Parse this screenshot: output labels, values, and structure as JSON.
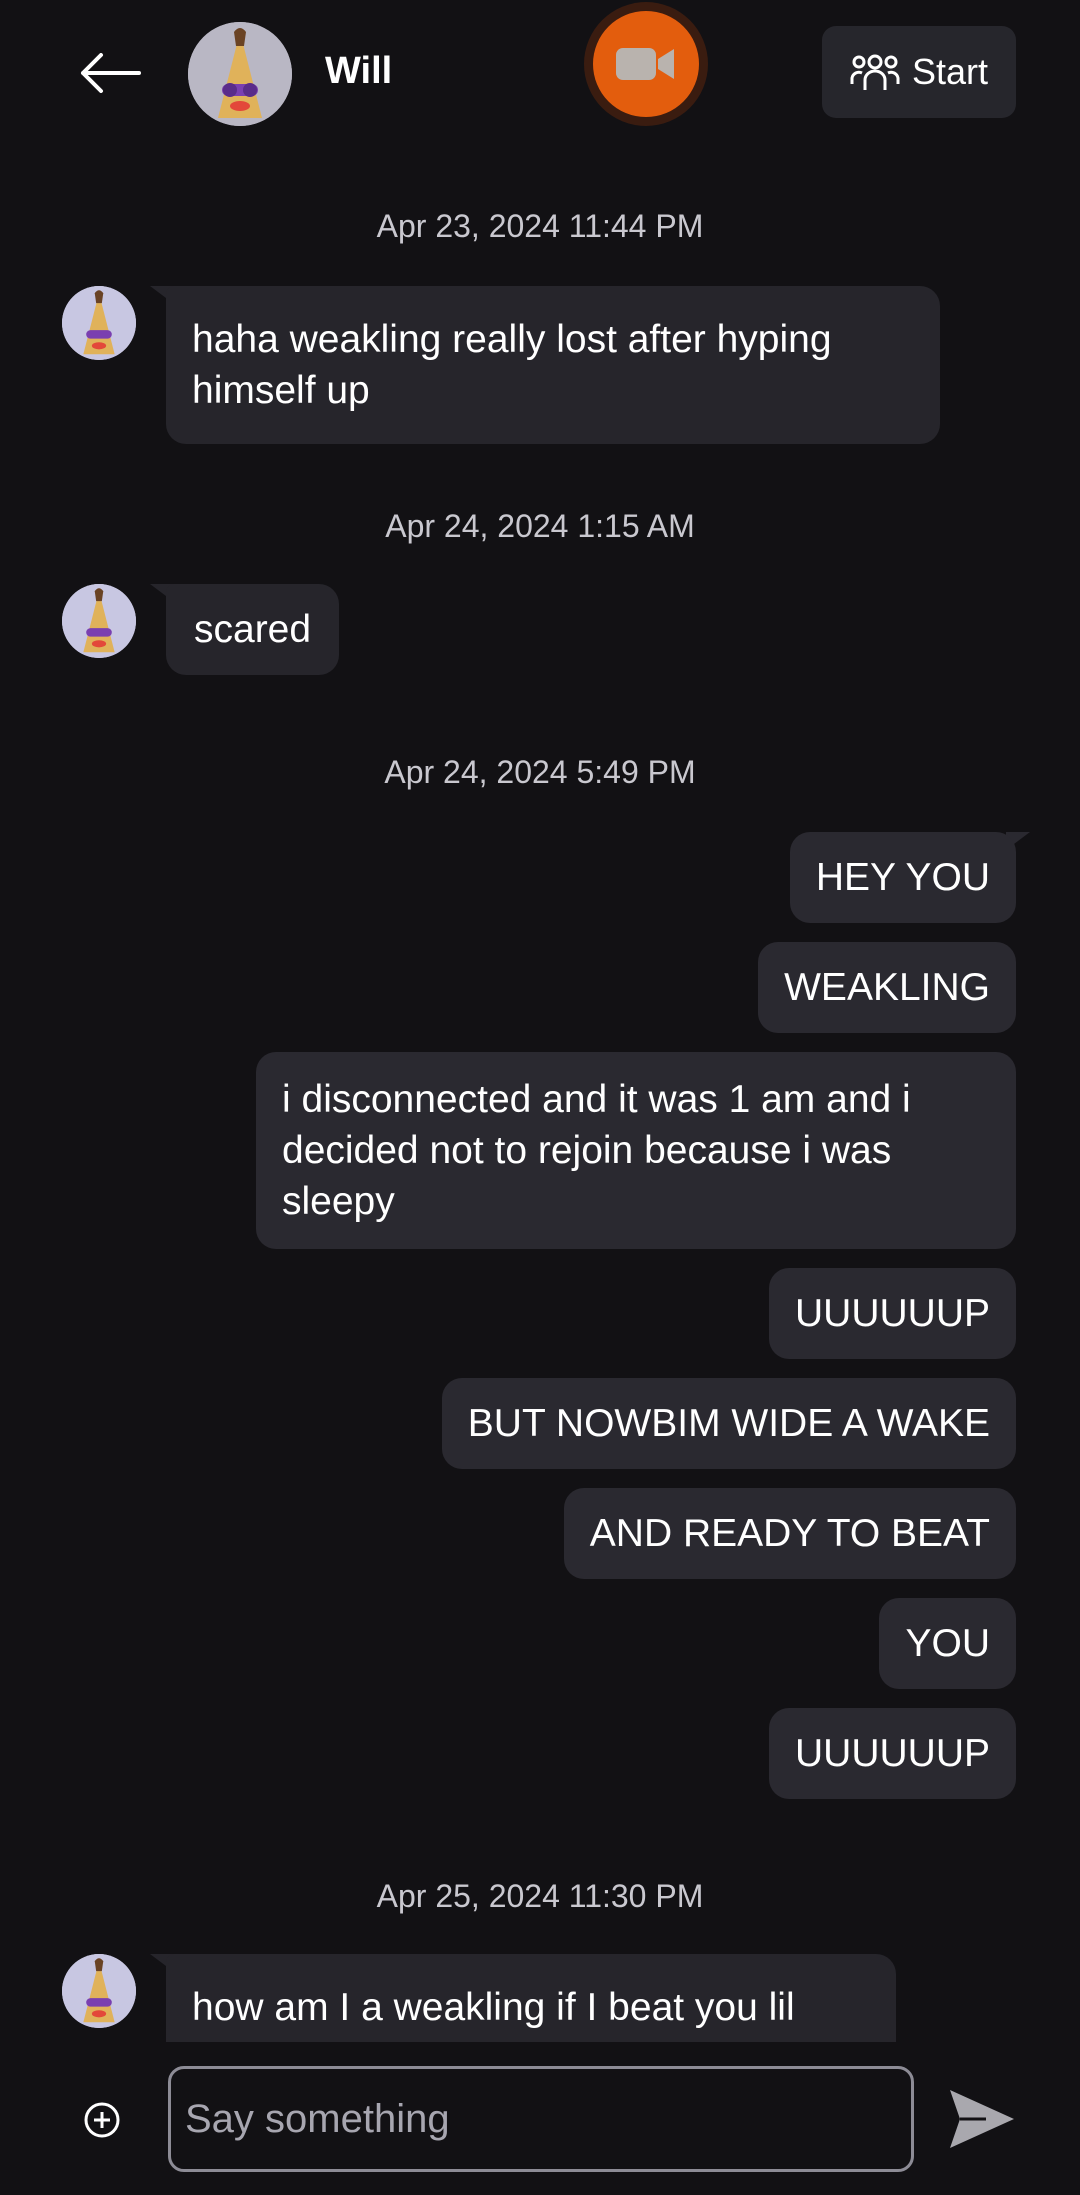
{
  "header": {
    "contact_name": "Will",
    "start_label": "Start",
    "accent_color": "#e35d0d"
  },
  "messages": [
    {
      "type": "timestamp",
      "text": "Apr 23, 2024 11:44 PM"
    },
    {
      "type": "incoming",
      "text": "haha weakling really lost after hyping himself up"
    },
    {
      "type": "timestamp",
      "text": "Apr 24, 2024 1:15 AM"
    },
    {
      "type": "incoming",
      "text": "scared"
    },
    {
      "type": "timestamp",
      "text": "Apr 24, 2024 5:49 PM"
    },
    {
      "type": "outgoing",
      "text": "HEY YOU"
    },
    {
      "type": "outgoing",
      "text": "WEAKLING"
    },
    {
      "type": "outgoing",
      "text": "i disconnected and it was 1 am and i decided not to rejoin because i was sleepy"
    },
    {
      "type": "outgoing",
      "text": "UUUUUUP"
    },
    {
      "type": "outgoing",
      "text": "BUT NOWBIM WIDE A WAKE"
    },
    {
      "type": "outgoing",
      "text": "AND READY TO BEAT"
    },
    {
      "type": "outgoing",
      "text": "YOU"
    },
    {
      "type": "outgoing",
      "text": "UUUUUUP"
    },
    {
      "type": "timestamp",
      "text": "Apr 25, 2024 11:30 PM"
    },
    {
      "type": "incoming",
      "text": "how am I a weakling if I beat you lil"
    }
  ],
  "composer": {
    "placeholder": "Say something"
  },
  "icons": {
    "back": "arrow-left-icon",
    "video": "video-camera-icon",
    "group": "people-group-icon",
    "add": "plus-circle-icon",
    "send": "send-icon"
  }
}
